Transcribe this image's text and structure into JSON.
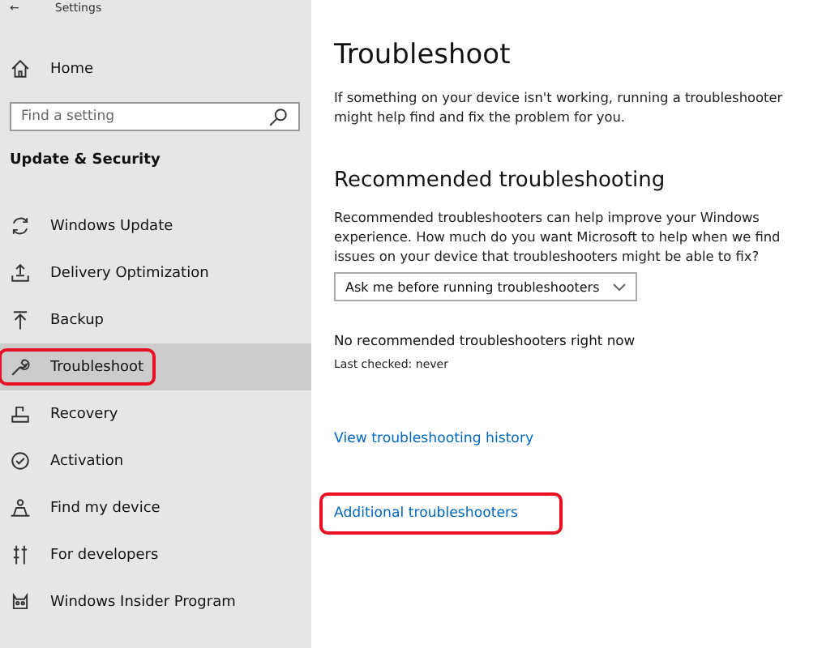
{
  "window": {
    "title": "Settings",
    "back": "←"
  },
  "sidebar": {
    "home": "Home",
    "search": {
      "placeholder": "Find a setting"
    },
    "section": "Update & Security",
    "items": [
      {
        "label": "Windows Update",
        "kind": "update",
        "selected": false,
        "highlighted": false
      },
      {
        "label": "Delivery Optimization",
        "kind": "delivery",
        "selected": false,
        "highlighted": false
      },
      {
        "label": "Backup",
        "kind": "backup",
        "selected": false,
        "highlighted": false
      },
      {
        "label": "Troubleshoot",
        "kind": "troubleshoot",
        "selected": true,
        "highlighted": true
      },
      {
        "label": "Recovery",
        "kind": "recovery",
        "selected": false,
        "highlighted": false
      },
      {
        "label": "Activation",
        "kind": "activation",
        "selected": false,
        "highlighted": false
      },
      {
        "label": "Find my device",
        "kind": "find",
        "selected": false,
        "highlighted": false
      },
      {
        "label": "For developers",
        "kind": "developer",
        "selected": false,
        "highlighted": false
      },
      {
        "label": "Windows Insider Program",
        "kind": "insider",
        "selected": false,
        "highlighted": false
      }
    ]
  },
  "main": {
    "title": "Troubleshoot",
    "intro": "If something on your device isn't working, running a troubleshooter might help find and fix the problem for you.",
    "section": "Recommended troubleshooting",
    "section_text": "Recommended troubleshooters can help improve your Windows experience. How much do you want Microsoft to help when we find issues on your device that troubleshooters might be able to fix?",
    "dropdown": {
      "value": "Ask me before running troubleshooters"
    },
    "status": "No recommended troubleshooters right now",
    "last_checked": "Last checked: never",
    "links": [
      {
        "label": "View troubleshooting history",
        "highlighted": false
      },
      {
        "label": "Additional troubleshooters",
        "highlighted": true
      }
    ]
  }
}
